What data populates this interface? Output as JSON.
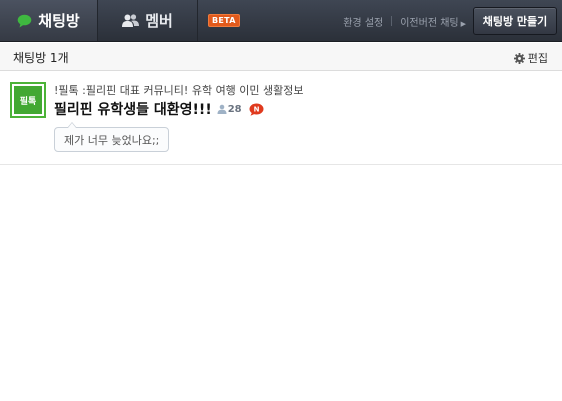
{
  "topbar": {
    "tabs": [
      {
        "label": "채팅방",
        "icon": "chat-bubble-icon",
        "active": true
      },
      {
        "label": "멤버",
        "icon": "members-icon",
        "active": false
      }
    ],
    "beta_label": "BETA",
    "links": {
      "settings": "환경 설정",
      "old_chat": "이전버전 채팅"
    },
    "create_button": "채팅방 만들기"
  },
  "subheader": {
    "room_count": "채팅방 1개",
    "edit_label": "편집"
  },
  "rooms": [
    {
      "thumb_label": "필톡",
      "description": "!필톡 :필리핀 대표 커뮤니티! 유학 여행 이민 생활정보",
      "title": "필리핀 유학생들 대환영!!!",
      "member_count": "28",
      "new_badge": "N",
      "last_message": "제가 너무 늦었나요;;"
    }
  ],
  "colors": {
    "topbar": "#2f343d",
    "active_tab": "#454c58",
    "beta": "#e25a1c",
    "thumb_green": "#42a832",
    "new_badge": "#e03a1e"
  }
}
